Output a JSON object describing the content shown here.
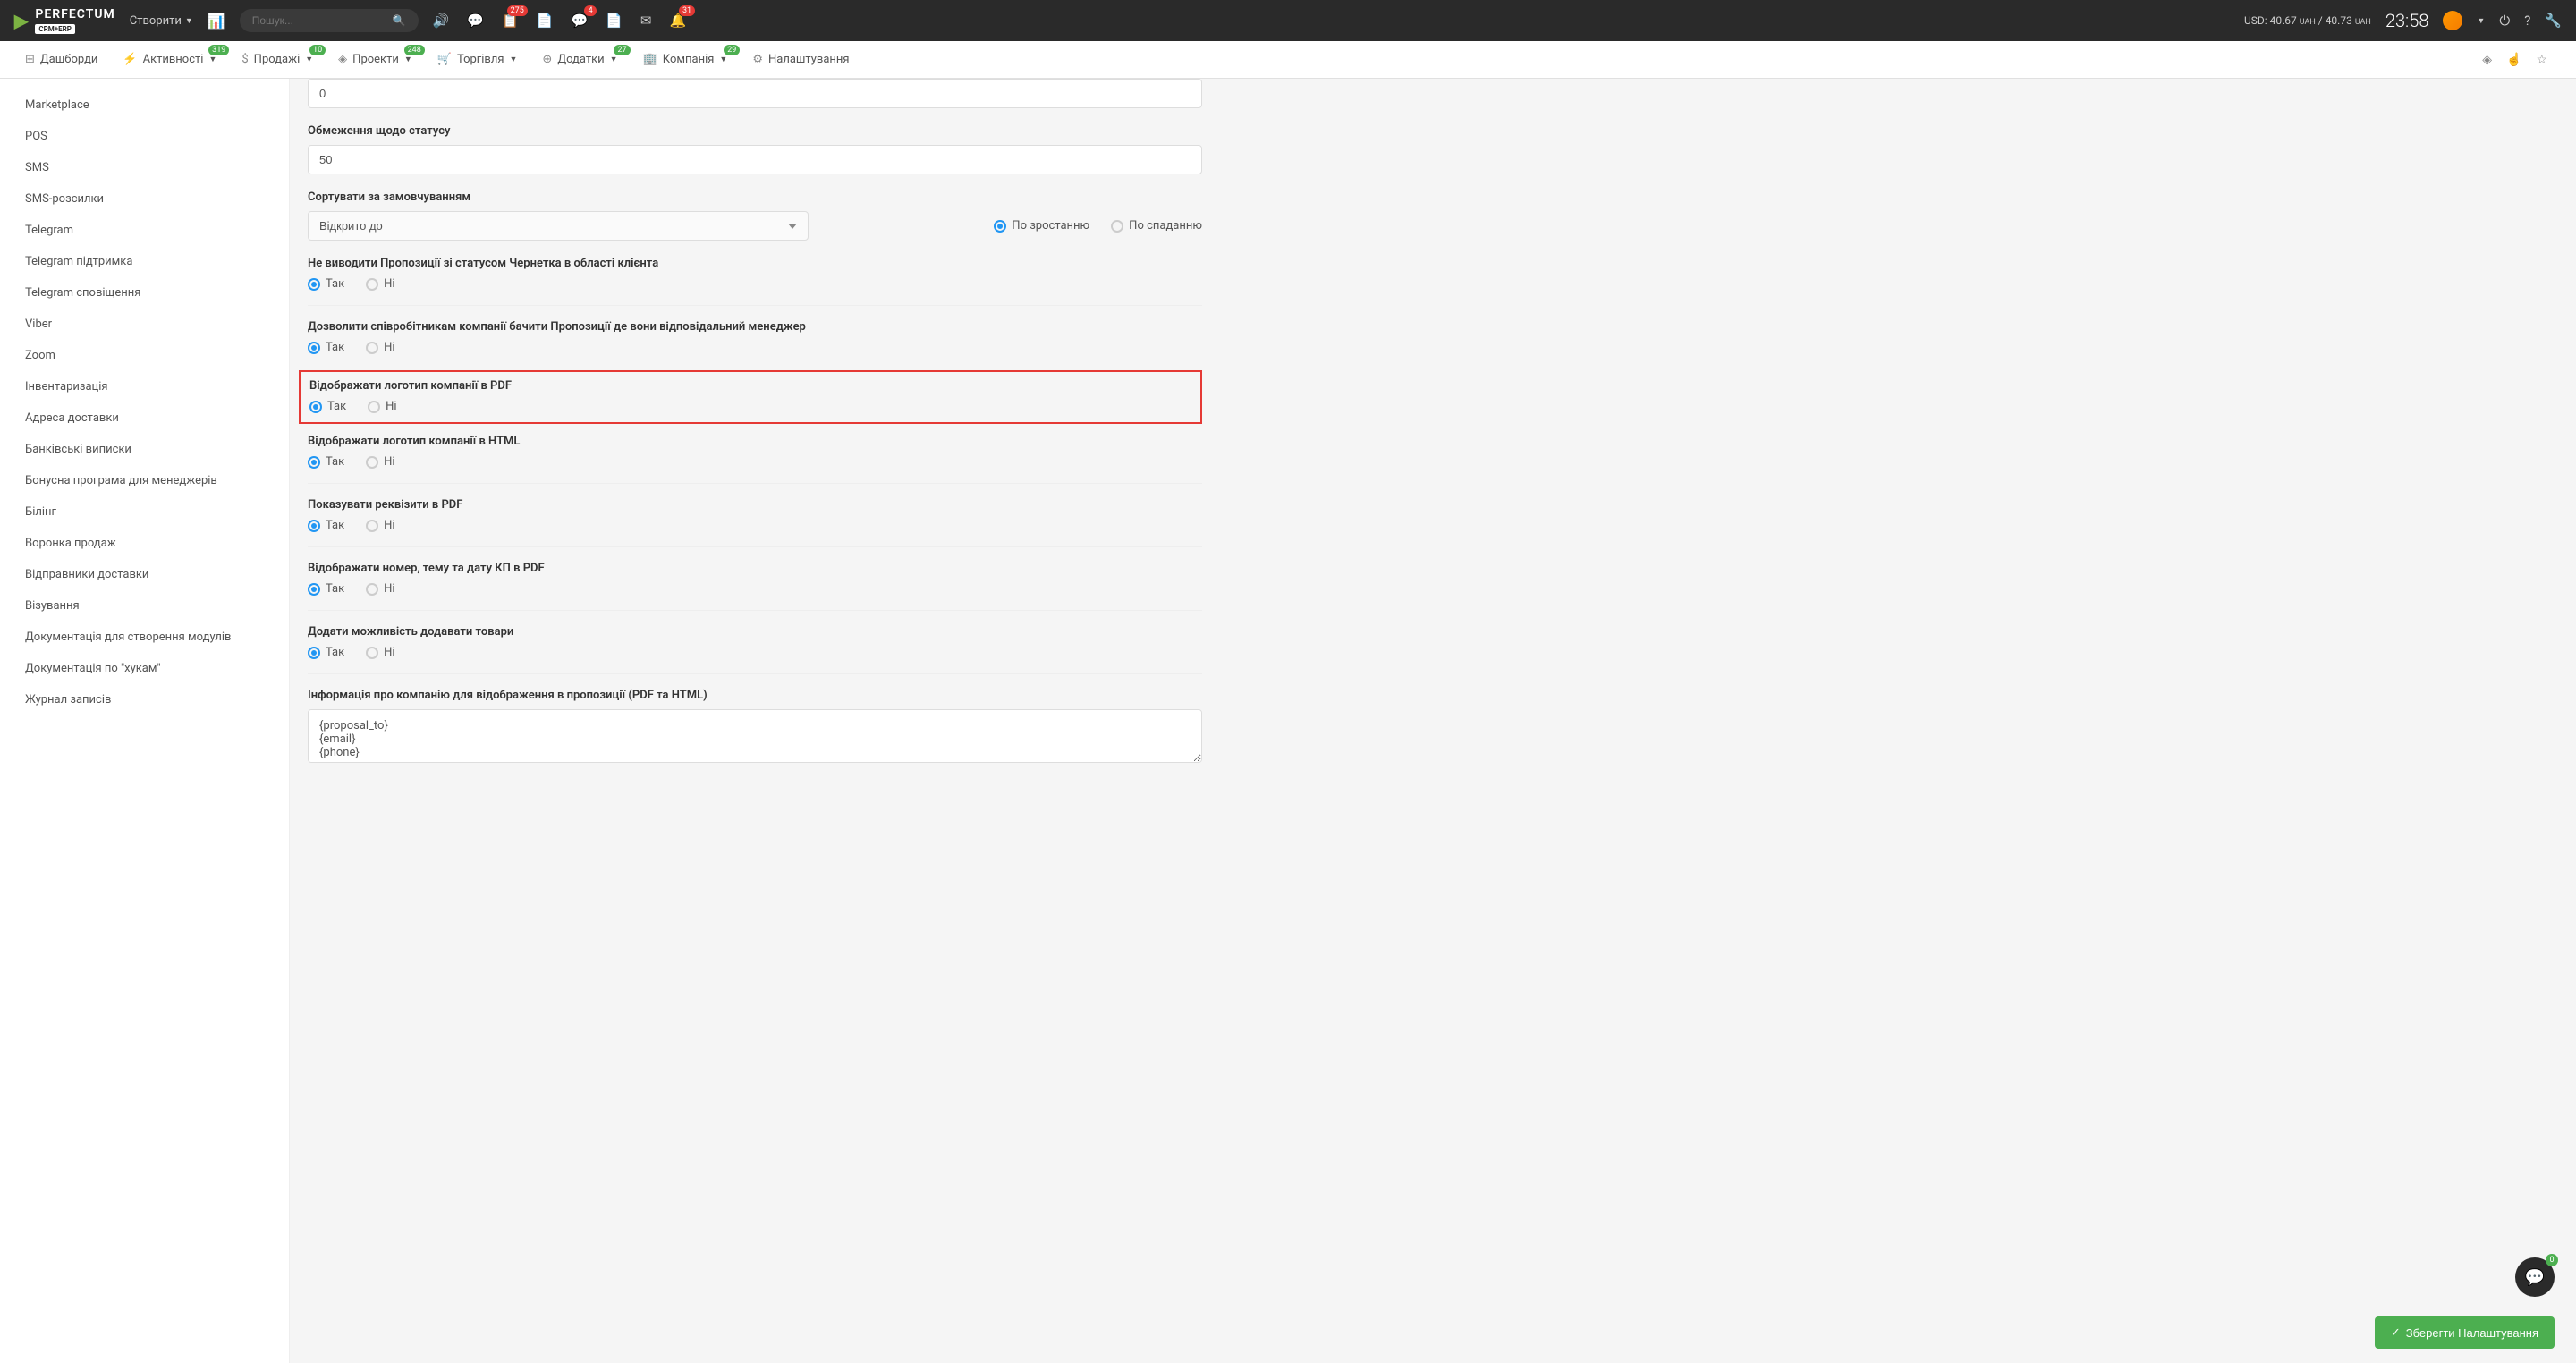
{
  "header": {
    "logo_text": "PERFECTUM",
    "logo_sub": "CRM+ERP",
    "create_label": "Створити",
    "search_placeholder": "Пошук...",
    "badges": {
      "msg1": "275",
      "msg2": "4",
      "bell": "31"
    },
    "currency": {
      "prefix": "USD:",
      "buy": "40.67",
      "unit": "UAH",
      "sep": "/",
      "sell": "40.73"
    },
    "clock": "23:58"
  },
  "nav": {
    "items": [
      {
        "label": "Дашборди",
        "badge": ""
      },
      {
        "label": "Активності",
        "badge": "319"
      },
      {
        "label": "Продажі",
        "badge": "10"
      },
      {
        "label": "Проекти",
        "badge": "248"
      },
      {
        "label": "Торгівля",
        "badge": ""
      },
      {
        "label": "Додатки",
        "badge": "27"
      },
      {
        "label": "Компанія",
        "badge": "29"
      },
      {
        "label": "Налаштування",
        "badge": ""
      }
    ]
  },
  "sidebar": {
    "items": [
      "Marketplace",
      "POS",
      "SMS",
      "SMS-розсилки",
      "Telegram",
      "Telegram підтримка",
      "Telegram сповіщення",
      "Viber",
      "Zoom",
      "Інвентаризація",
      "Адреса доставки",
      "Банківські виписки",
      "Бонусна програма для менеджерів",
      "Білінг",
      "Воронка продаж",
      "Відправники доставки",
      "Візування",
      "Документація для створення модулів",
      "Документація по \"хукам\"",
      "Журнал записів"
    ]
  },
  "form": {
    "field0_value": "0",
    "limit_label": "Обмеження щодо статусу",
    "limit_value": "50",
    "sort_label": "Сортувати за замовчуванням",
    "sort_value": "Відкрито до",
    "sort_asc": "По зростанню",
    "sort_desc": "По спаданню",
    "q1": "Не виводити Пропозиції зі статусом Чернетка в області клієнта",
    "q2": "Дозволити співробітникам компанії бачити Пропозиції де вони відповідальний менеджер",
    "q3": "Відображати логотип компанії в PDF",
    "q4": "Відображати логотип компанії в HTML",
    "q5": "Показувати реквізити в PDF",
    "q6": "Відображати номер, тему та дату КП в PDF",
    "q7": "Додати можливість додавати товари",
    "yes": "Так",
    "no": "Ні",
    "info_label": "Інформація про компанію для відображення в пропозиції (PDF та HTML)",
    "info_value": "{proposal_to}\n{email}\n{phone}",
    "save_label": "Зберегти Налаштування",
    "fab_badge": "0"
  }
}
